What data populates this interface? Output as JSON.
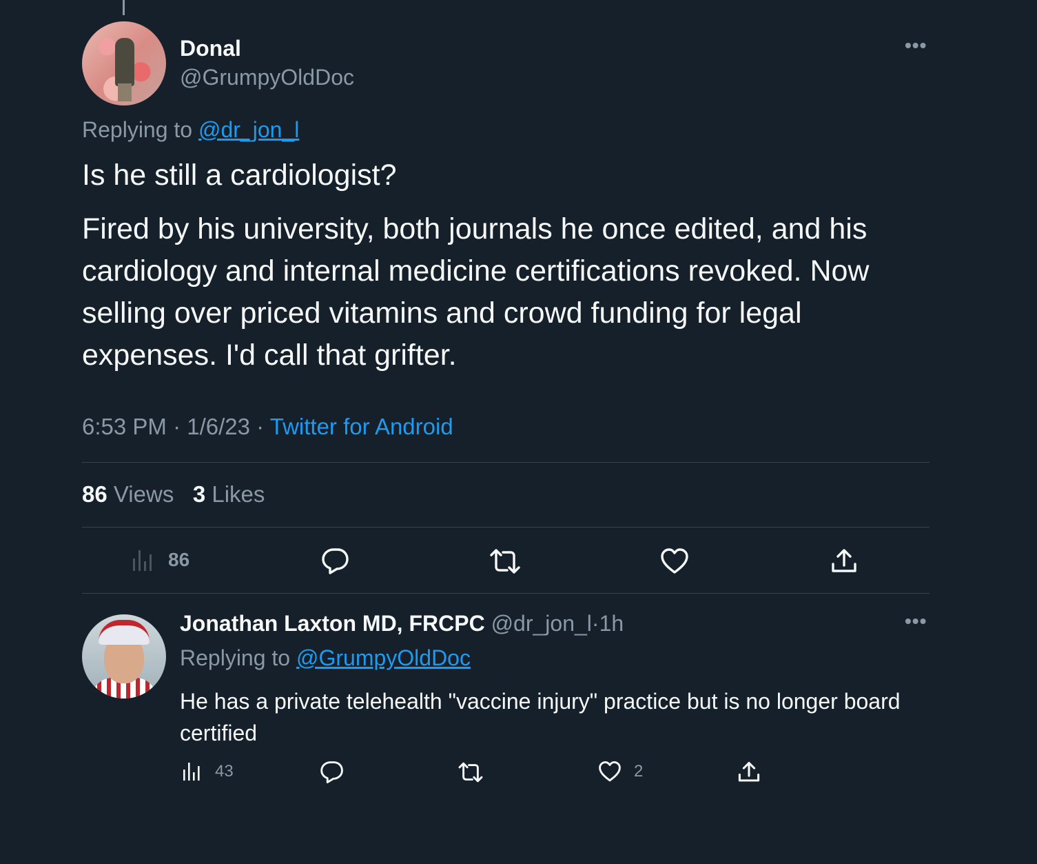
{
  "main_tweet": {
    "name": "Donal",
    "handle": "@GrumpyOldDoc",
    "replying_prefix": "Replying to",
    "replying_to": "@dr_jon_l",
    "text_paragraph_1": "Is he still a cardiologist?",
    "text_paragraph_2": "Fired by his university, both journals he once edited, and his cardiology and internal medicine certifications revoked. Now selling over priced vitamins and crowd funding for legal expenses. I'd call that grifter.",
    "time": "6:53 PM",
    "date": "1/6/23",
    "source": "Twitter for Android",
    "views_count": "86",
    "views_label": "Views",
    "likes_count": "3",
    "likes_label": "Likes",
    "more_label": "•••",
    "actions": {
      "views": {
        "icon": "analytics-icon",
        "count": "86"
      },
      "reply": {
        "icon": "reply-icon"
      },
      "retweet": {
        "icon": "retweet-icon"
      },
      "like": {
        "icon": "heart-icon"
      },
      "share": {
        "icon": "share-icon"
      }
    }
  },
  "reply_tweet": {
    "name": "Jonathan Laxton MD, FRCPC",
    "handle": "@dr_jon_l",
    "time_ago": "1h",
    "separator": "·",
    "replying_prefix": "Replying to",
    "replying_to": "@GrumpyOldDoc",
    "text": "He has a private telehealth \"vaccine injury\" practice but is no longer board certified",
    "more_label": "•••",
    "actions": {
      "views": {
        "icon": "analytics-icon",
        "count": "43"
      },
      "reply": {
        "icon": "reply-icon"
      },
      "retweet": {
        "icon": "retweet-icon"
      },
      "like": {
        "icon": "heart-icon",
        "count": "2"
      },
      "share": {
        "icon": "share-icon"
      }
    }
  },
  "colors": {
    "background": "#15202b",
    "text_primary": "#f7f9f9",
    "text_secondary": "#8b98a5",
    "link": "#1d9bf0",
    "divider": "#38444d"
  }
}
